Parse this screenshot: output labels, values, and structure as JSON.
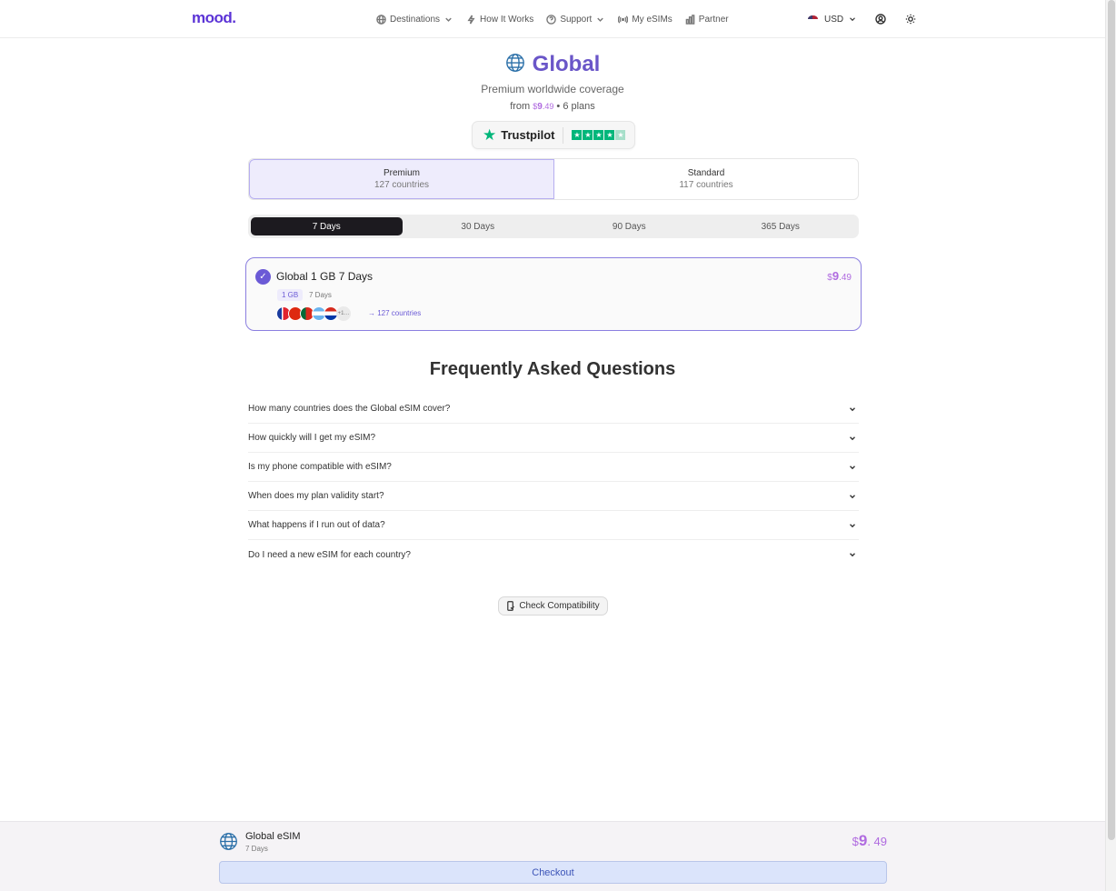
{
  "header": {
    "logo": "mood.",
    "nav": [
      {
        "label": "Destinations",
        "icon": "globe-icon",
        "dropdown": true
      },
      {
        "label": "How It Works",
        "icon": "lightning-icon",
        "dropdown": false
      },
      {
        "label": "Support",
        "icon": "help-icon",
        "dropdown": true
      },
      {
        "label": "My eSIMs",
        "icon": "signal-icon",
        "dropdown": false
      },
      {
        "label": "Partner",
        "icon": "chart-icon",
        "dropdown": false
      }
    ],
    "currency": "USD"
  },
  "hero": {
    "title": "Global",
    "subtitle": "Premium worldwide coverage",
    "from_label": "from",
    "from_price_symbol": "$",
    "from_price_whole": "9",
    "from_price_decimal": ".49",
    "plans_text": "• 6 plans"
  },
  "trustpilot": {
    "name": "Trustpilot",
    "rating_stars": 4.5
  },
  "plan_types": [
    {
      "title": "Premium",
      "subtitle": "127 countries",
      "active": true
    },
    {
      "title": "Standard",
      "subtitle": "117 countries",
      "active": false
    }
  ],
  "durations": [
    {
      "label": "7 Days",
      "active": true
    },
    {
      "label": "30 Days",
      "active": false
    },
    {
      "label": "90 Days",
      "active": false
    },
    {
      "label": "365 Days",
      "active": false
    }
  ],
  "plan_card": {
    "name": "Global 1 GB 7 Days",
    "price_symbol": "$",
    "price_whole": "9",
    "price_decimal": ".49",
    "data_chip": "1 GB",
    "days_chip": "7 Days",
    "more_flags": "+1…",
    "countries_link": "127 countries"
  },
  "faq": {
    "title": "Frequently Asked Questions",
    "items": [
      "How many countries does the Global eSIM cover?",
      "How quickly will I get my eSIM?",
      "Is my phone compatible with eSIM?",
      "When does my plan validity start?",
      "What happens if I run out of data?",
      "Do I need a new eSIM for each country?"
    ]
  },
  "compat_button": "Check Compatibility",
  "bottom_bar": {
    "title": "Global eSIM",
    "days": "7 Days",
    "price_symbol": "$",
    "price_whole": "9",
    "price_decimal": ". 49",
    "checkout": "Checkout"
  },
  "colors": {
    "brand": "#5b33d6",
    "accent": "#6b5ad6",
    "price": "#b06be0",
    "trustpilot": "#00b67a"
  }
}
